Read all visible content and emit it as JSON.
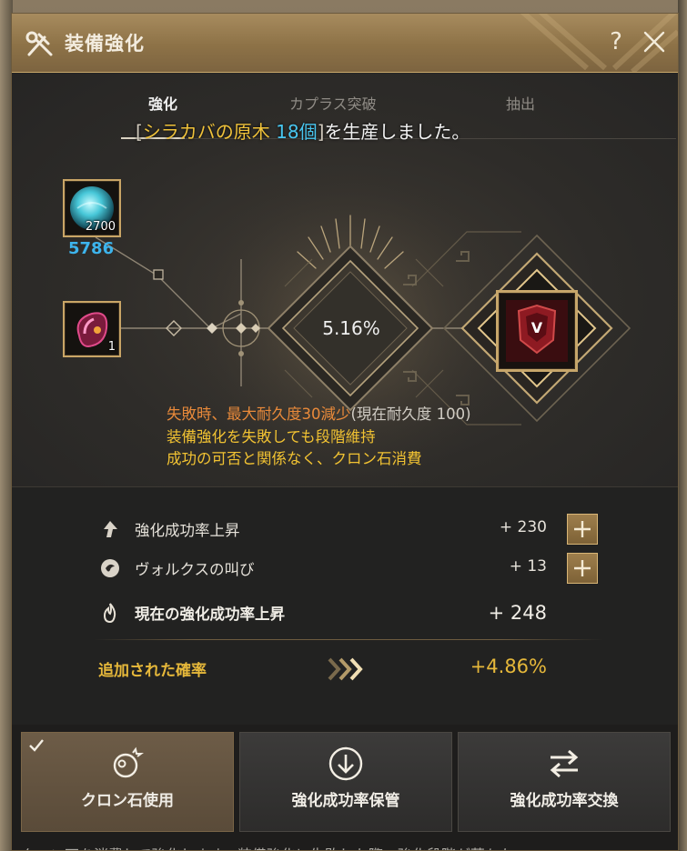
{
  "window": {
    "title": "装備強化",
    "help": "?"
  },
  "tabs": [
    {
      "label": "強化",
      "active": true
    },
    {
      "label": "カプラス突破",
      "active": false
    },
    {
      "label": "抽出",
      "active": false
    }
  ],
  "notice": {
    "open": "[",
    "item": "シラカバの原木",
    "qty": "18個",
    "close": "]",
    "rest": "を生産しました。"
  },
  "materials": {
    "stone_slot_count": "2700",
    "stone_owned": "5786",
    "crystal_slot_count": "1"
  },
  "success_chance": "5.16%",
  "target_item_grade": "V",
  "warnings": {
    "line1_main": "失敗時、最大耐久度30減少",
    "line1_sub": "(現在耐久度 100)",
    "line2": "装備強化を失敗しても段階維持",
    "line3": "成功の可否と関係なく、クロン石消費"
  },
  "stats": {
    "rate_up_label": "強化成功率上昇",
    "rate_up_value": "+ 230",
    "cry_label": "ヴォルクスの叫び",
    "cry_value": "+ 13",
    "current_label": "現在の強化成功率上昇",
    "current_value": "+ 248",
    "added_label": "追加された確率",
    "added_value": "+4.86%"
  },
  "buttons": [
    {
      "label": "クロン石使用",
      "checked": true
    },
    {
      "label": "強化成功率保管"
    },
    {
      "label": "強化成功率交換"
    }
  ],
  "footer": "クロン石を消費して強化します。装備強化に失敗した際、強化段階が落ちた",
  "colors": {
    "accent_gold": "#e6b83a",
    "item_yellow": "#f0c23a",
    "qty_blue": "#48c6f0",
    "warning_orange": "#e98a3a",
    "titlebar": "#8d7247"
  }
}
